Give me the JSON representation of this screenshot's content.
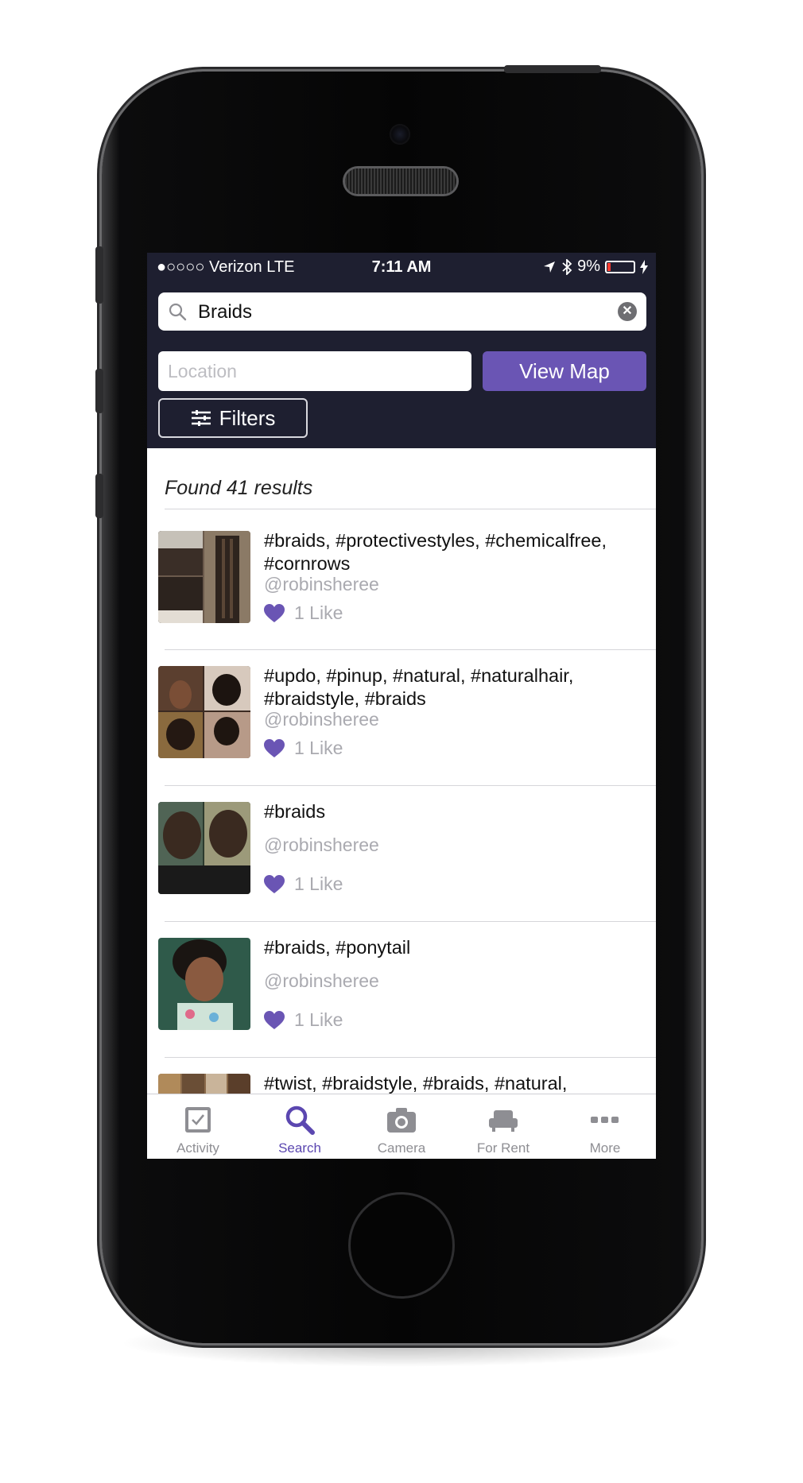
{
  "status_bar": {
    "carrier": "●○○○○ Verizon   LTE",
    "time": "7:11 AM",
    "battery": "9%"
  },
  "search": {
    "value": "Braids"
  },
  "location": {
    "placeholder": "Location"
  },
  "view_map_label": "View Map",
  "filters_label": "Filters",
  "results_heading": "Found 41 results",
  "results": [
    {
      "tags_line1": "#braids, #protectivestyles, #chemicalfree,",
      "tags_line2": "#cornrows",
      "user": "@robinsheree",
      "likes": "1 Like"
    },
    {
      "tags_line1": "#updo, #pinup, #natural, #naturalhair,",
      "tags_line2": "#braidstyle, #braids",
      "user": "@robinsheree",
      "likes": "1 Like"
    },
    {
      "tags_line1": "#braids",
      "tags_line2": "",
      "user": "@robinsheree",
      "likes": "1 Like"
    },
    {
      "tags_line1": "#braids, #ponytail",
      "tags_line2": "",
      "user": "@robinsheree",
      "likes": "1 Like"
    },
    {
      "tags_line1": "#twist, #braidstyle, #braids, #natural,",
      "tags_line2": "",
      "user": "",
      "likes": ""
    }
  ],
  "tabs": [
    {
      "label": "Activity",
      "icon": "checkbox-icon"
    },
    {
      "label": "Search",
      "icon": "search-icon"
    },
    {
      "label": "Camera",
      "icon": "camera-icon"
    },
    {
      "label": "For Rent",
      "icon": "chair-icon"
    },
    {
      "label": "More",
      "icon": "more-icon"
    }
  ],
  "colors": {
    "header": "#1e1f30",
    "accent": "#6a55b4",
    "heart": "#6a55b4"
  }
}
